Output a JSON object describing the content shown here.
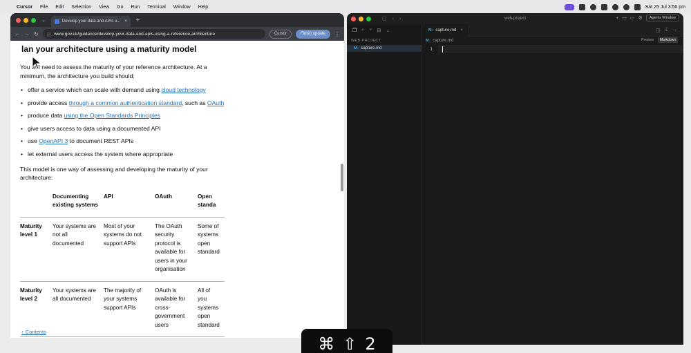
{
  "menubar": {
    "app": "Cursor",
    "items": [
      "File",
      "Edit",
      "Selection",
      "View",
      "Go",
      "Run",
      "Terminal",
      "Window",
      "Help"
    ],
    "datetime": "Sat 25 Jul  3:56 pm"
  },
  "browser": {
    "tab_title": "Develop your data and APIs u...",
    "tab_close": "×",
    "new_tab": "+",
    "url": "www.gov.uk/guidance/develop-your-data-and-apis-using-a-reference-architecture",
    "cursor_pill": "Cursor",
    "update_pill": "Finish update",
    "page": {
      "heading": "lan your architecture using a maturity model",
      "intro": "You will need to assess the maturity of your reference architecture. At a minimum, the architecture you build should:",
      "bullets": [
        {
          "before": "offer a service which can scale with demand using ",
          "link": "cloud technology",
          "after": ""
        },
        {
          "before": "provide access ",
          "link": "through a common authentication standard",
          "after": ", such as ",
          "link2": "OAuth"
        },
        {
          "before": "produce data ",
          "link": "using the Open Standards Principles",
          "after": ""
        },
        {
          "before": "give users access to data using a documented API",
          "link": "",
          "after": ""
        },
        {
          "before": "use ",
          "link": "OpenAPI 3",
          "after": " to document REST APIs"
        },
        {
          "before": "let external users access the system where appropriate",
          "link": "",
          "after": ""
        }
      ],
      "model_text": "This model is one way of assessing and developing the maturity of your architecture:",
      "table": {
        "headers": [
          "",
          "Documenting existing systems",
          "API",
          "OAuth",
          "Open standa"
        ],
        "rows": [
          [
            "Maturity level 1",
            "Your systems are not all documented",
            "Most of your systems do not support APIs",
            "The OAuth security protocol is available for users in your organisation",
            "Some of systems open standard"
          ],
          [
            "Maturity level 2",
            "Your systems are all documented",
            "The majority of your systems support APIs",
            "OAuth is available for cross-government users",
            "All of you systems open standard"
          ]
        ]
      },
      "contents_link": "↑ Contents"
    }
  },
  "editor": {
    "project_title": "web-project",
    "agents_button": "Agents Window",
    "explorer_header": "WEB-PROJECT",
    "file_badge": "M↓",
    "file_name": "capture.md",
    "tab_name": "capture.md",
    "tab_close": "×",
    "breadcrumb": "capture.md",
    "preview_label": "Preview",
    "markdown_label": "Markdown",
    "line_number": "1"
  },
  "keystroke": {
    "cmd": "⌘",
    "shift": "⇧",
    "key": "2"
  }
}
